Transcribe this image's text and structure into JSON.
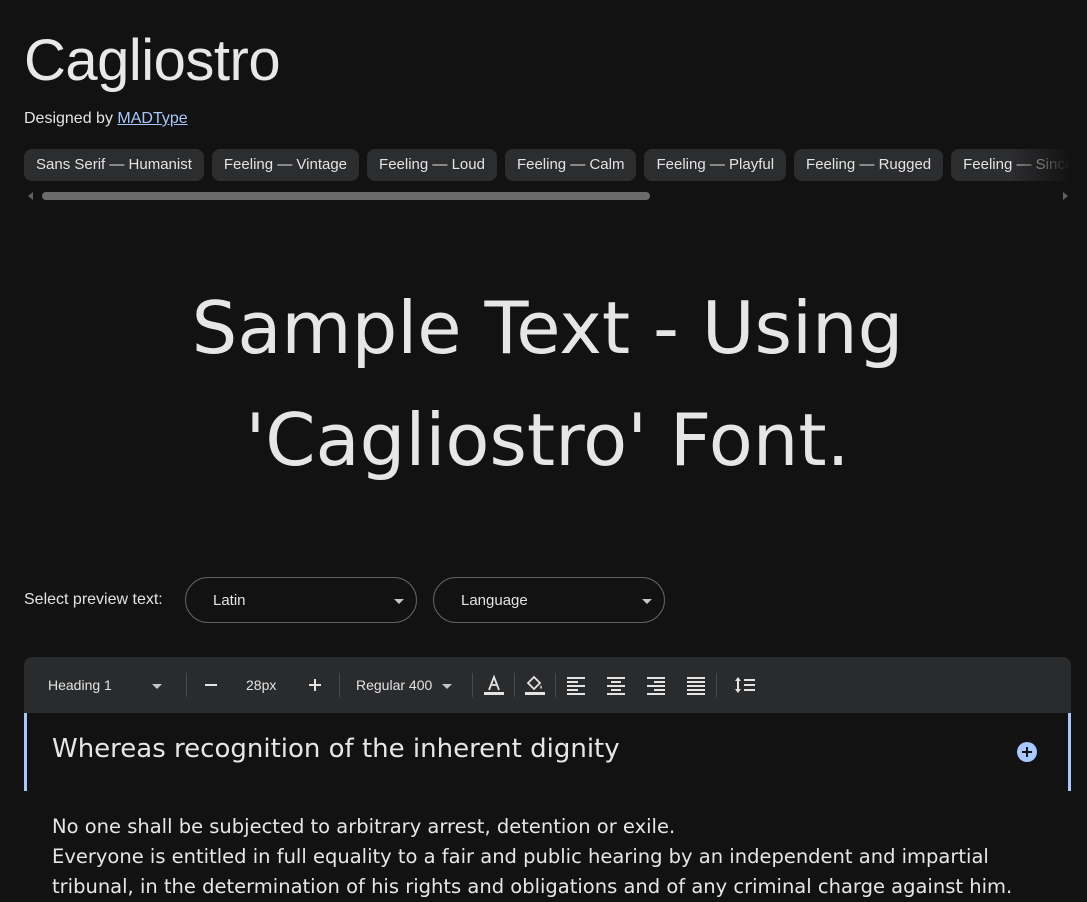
{
  "font": {
    "name": "Cagliostro",
    "designed_by_label": "Designed by",
    "designer": "MADType"
  },
  "tags": [
    "Sans Serif — Humanist",
    "Feeling — Vintage",
    "Feeling — Loud",
    "Feeling — Calm",
    "Feeling — Playful",
    "Feeling — Rugged",
    "Feeling — Sincere"
  ],
  "sample_text": "Sample Text - Using 'Cagliostro' Font.",
  "preview": {
    "label": "Select preview text:",
    "script_value": "Latin",
    "language_placeholder": "Language"
  },
  "toolbar": {
    "style": "Heading 1",
    "size": "28px",
    "minus_icon": "minus-icon",
    "plus_icon": "plus-icon",
    "weight": "Regular 400",
    "icons": [
      "text-color-icon",
      "fill-color-icon",
      "align-left-icon",
      "align-center-icon",
      "align-right-icon",
      "align-justify-icon",
      "line-height-icon"
    ]
  },
  "editor": {
    "heading": "Whereas recognition of the inherent dignity",
    "paragraphs": [
      "No one shall be subjected to arbitrary arrest, detention or exile.",
      "Everyone is entitled in full equality to a fair and public hearing by an independent and impartial tribunal, in the determination of his rights and obligations and of any criminal charge against him."
    ]
  },
  "colors": {
    "background": "#121212",
    "accent": "#a8c7fa",
    "chip": "#2c2d2f",
    "toolbar": "#2a2b2d"
  }
}
